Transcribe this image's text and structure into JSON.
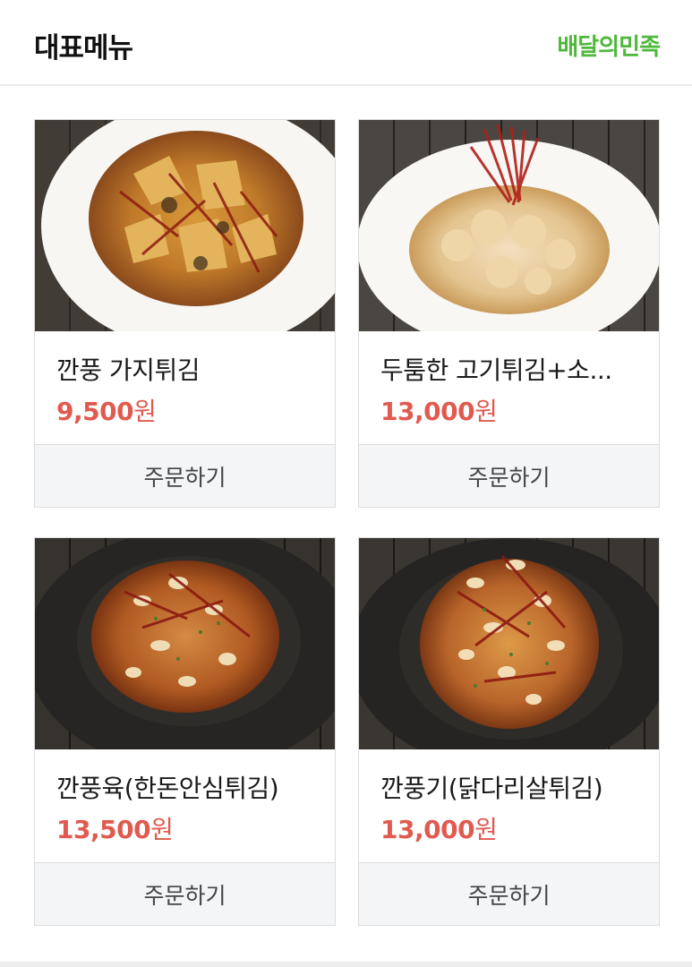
{
  "header": {
    "title": "대표메뉴",
    "brand": "배달의민족",
    "brand_color": "#4fb83c"
  },
  "menu": {
    "price_color": "#e05a4f",
    "items": [
      {
        "name": "깐풍 가지튀김",
        "price_number": "9,500",
        "price_unit": "원",
        "order_label": "주문하기",
        "photo": "eggplant-fritter-white-plate"
      },
      {
        "name": "두툼한 고기튀김+소...",
        "price_number": "13,000",
        "price_unit": "원",
        "order_label": "주문하기",
        "photo": "pork-fritter-white-plate"
      },
      {
        "name": "깐풍육(한돈안심튀김)",
        "price_number": "13,500",
        "price_unit": "원",
        "order_label": "주문하기",
        "photo": "kkanpung-pork-dark-plate"
      },
      {
        "name": "깐풍기(닭다리살튀김)",
        "price_number": "13,000",
        "price_unit": "원",
        "order_label": "주문하기",
        "photo": "kkanpung-chicken-dark-plate"
      }
    ]
  }
}
